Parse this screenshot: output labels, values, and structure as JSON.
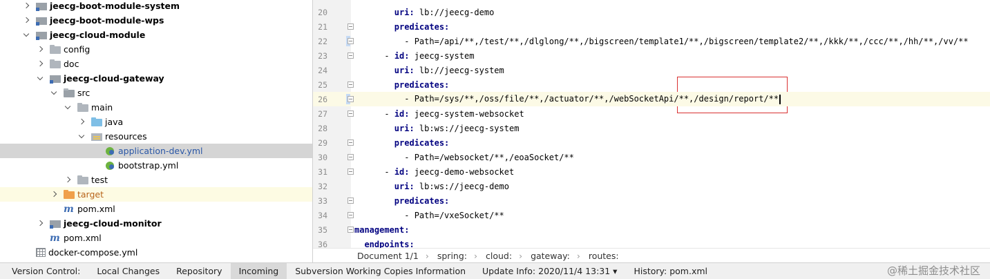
{
  "tree": {
    "items": [
      {
        "label": "jeecg-boot-module-system",
        "bold": true,
        "arrow": "right",
        "icon": "module"
      },
      {
        "label": "jeecg-boot-module-wps",
        "bold": true,
        "arrow": "right",
        "icon": "module"
      },
      {
        "label": "jeecg-cloud-module",
        "bold": true,
        "arrow": "down",
        "icon": "module"
      },
      {
        "label": "config",
        "arrow": "right",
        "icon": "folder"
      },
      {
        "label": "doc",
        "arrow": "right",
        "icon": "folder"
      },
      {
        "label": "jeecg-cloud-gateway",
        "bold": true,
        "arrow": "down",
        "icon": "module"
      },
      {
        "label": "src",
        "arrow": "down",
        "icon": "folder-src"
      },
      {
        "label": "main",
        "arrow": "down",
        "icon": "folder"
      },
      {
        "label": "java",
        "arrow": "right",
        "icon": "folder-java"
      },
      {
        "label": "resources",
        "arrow": "down",
        "icon": "resources-folder"
      },
      {
        "label": "application-dev.yml",
        "arrow": "none",
        "icon": "spring-yml",
        "selected": true
      },
      {
        "label": "bootstrap.yml",
        "arrow": "none",
        "icon": "spring-yml"
      },
      {
        "label": "test",
        "arrow": "right",
        "icon": "folder"
      },
      {
        "label": "target",
        "arrow": "right",
        "icon": "folder-target",
        "excluded": true
      },
      {
        "label": "pom.xml",
        "arrow": "none",
        "icon": "maven"
      },
      {
        "label": "jeecg-cloud-monitor",
        "bold": true,
        "arrow": "right",
        "icon": "module"
      },
      {
        "label": "pom.xml",
        "arrow": "none",
        "icon": "maven"
      },
      {
        "label": "docker-compose.yml",
        "arrow": "none",
        "icon": "compose"
      }
    ]
  },
  "editor": {
    "lines": [
      {
        "num": "20",
        "text": "        uri: lb://jeecg-demo"
      },
      {
        "num": "21",
        "text": "        predicates:"
      },
      {
        "num": "22",
        "text": "          - Path=/api/**,/test/**,/dlglong/**,/bigscreen/template1/**,/bigscreen/template2/**,/kkk/**,/ccc/**,/hh/**,/vv/**"
      },
      {
        "num": "23",
        "text": "      - id: jeecg-system"
      },
      {
        "num": "24",
        "text": "        uri: lb://jeecg-system"
      },
      {
        "num": "25",
        "text": "        predicates:"
      },
      {
        "num": "26",
        "text": "          - Path=/sys/**,/oss/file/**,/actuator/**,/webSocketApi/**,/design/report/**"
      },
      {
        "num": "27",
        "text": "      - id: jeecg-system-websocket"
      },
      {
        "num": "28",
        "text": "        uri: lb:ws://jeecg-system"
      },
      {
        "num": "29",
        "text": "        predicates:"
      },
      {
        "num": "30",
        "text": "          - Path=/websocket/**,/eoaSocket/**"
      },
      {
        "num": "31",
        "text": "      - id: jeecg-demo-websocket"
      },
      {
        "num": "32",
        "text": "        uri: lb:ws://jeecg-demo"
      },
      {
        "num": "33",
        "text": "        predicates:"
      },
      {
        "num": "34",
        "text": "          - Path=/vxeSocket/**"
      },
      {
        "num": "35",
        "text": "management:"
      },
      {
        "num": "36",
        "text": "  endpoints:"
      }
    ],
    "current_line": "26"
  },
  "breadcrumb": {
    "items": [
      "Document 1/1",
      "spring:",
      "cloud:",
      "gateway:",
      "routes:"
    ]
  },
  "bottom_bar": {
    "items": [
      {
        "label": "Version Control:"
      },
      {
        "label": "Local Changes"
      },
      {
        "label": "Repository"
      },
      {
        "label": "Incoming",
        "active": true
      },
      {
        "label": "Subversion Working Copies Information"
      },
      {
        "label": "Update Info: 2020/11/4 13:31 ▾"
      },
      {
        "label": "History: pom.xml"
      }
    ],
    "watermark": "@稀土掘金技术社区"
  },
  "colors": {
    "key": "#000080",
    "selection": "#d5d5d5",
    "current_line": "#fcfae6",
    "highlight_box": "#d93030"
  }
}
